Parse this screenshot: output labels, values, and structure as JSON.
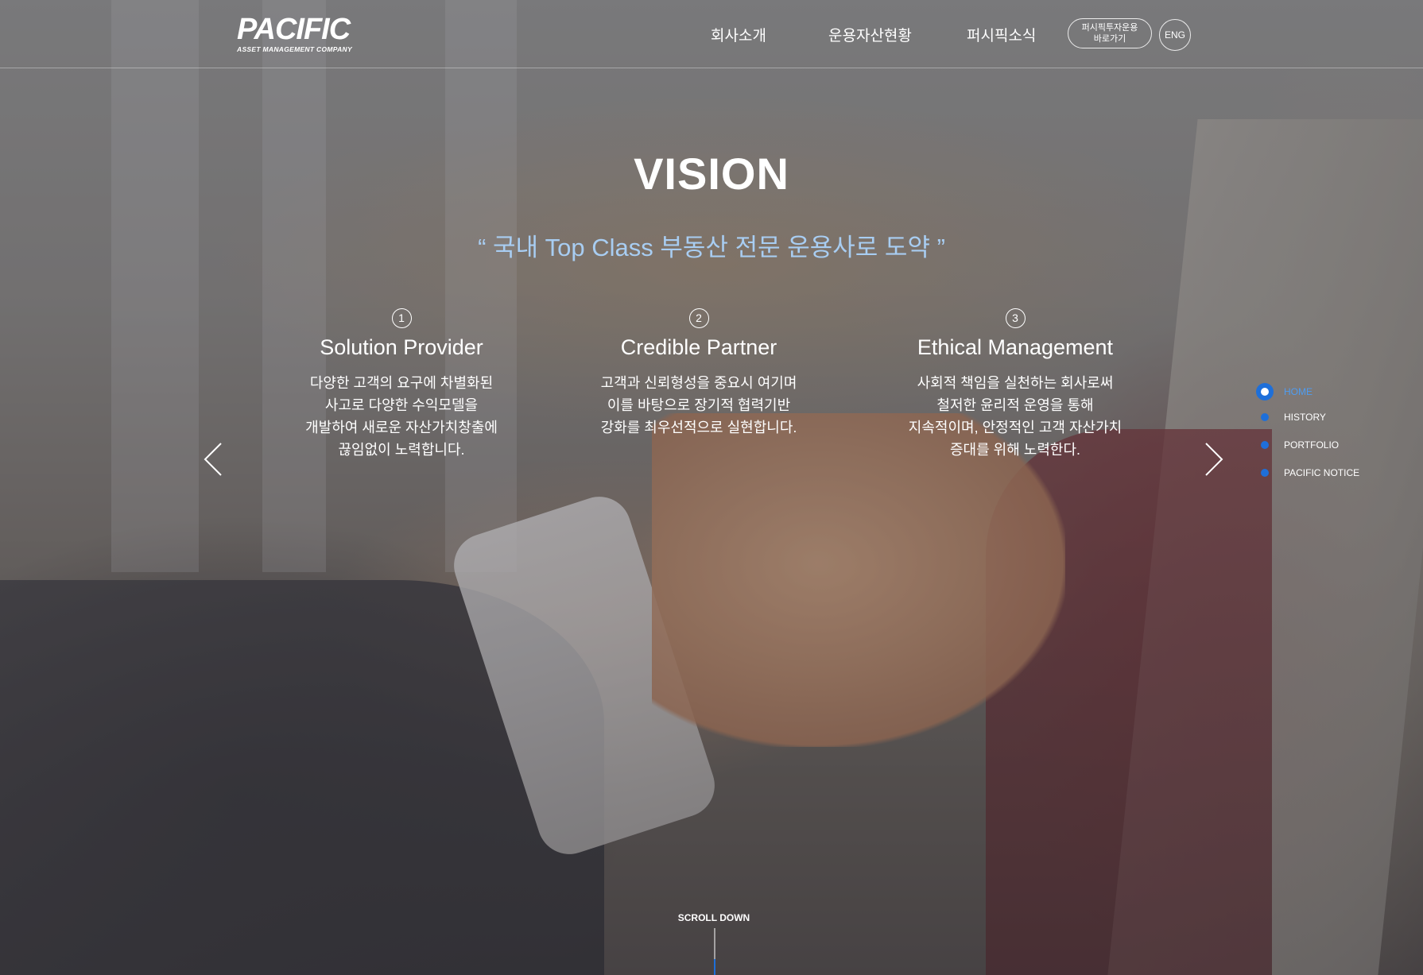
{
  "header": {
    "logo_main": "PACIFIC",
    "logo_sub": "ASSET MANAGEMENT COMPANY",
    "nav": [
      "회사소개",
      "운용자산현황",
      "퍼시픽소식"
    ],
    "shortcut_line1": "퍼시픽투자운용",
    "shortcut_line2": "바로가기",
    "lang": "ENG"
  },
  "hero": {
    "title": "VISION",
    "quote": "“ 국내 Top Class 부동산 전문 운용사로 도약 ”",
    "pillars": [
      {
        "num": "1",
        "title": "Solution Provider",
        "desc": "다양한 고객의 요구에 차별화된\n사고로 다양한 수익모델을\n개발하여 새로운 자산가치창출에\n끊임없이 노력합니다."
      },
      {
        "num": "2",
        "title": "Credible Partner",
        "desc": "고객과 신뢰형성을 중요시 여기며\n이를 바탕으로 장기적 협력기반\n강화를 최우선적으로 실현합니다."
      },
      {
        "num": "3",
        "title": "Ethical Management",
        "desc": "사회적 책임을 실천하는 회사로써\n철저한 윤리적 운영을 통해\n지속적이며, 안정적인 고객 자산가치\n증대를 위해 노력한다."
      }
    ]
  },
  "side_nav": {
    "items": [
      "HOME",
      "HISTORY",
      "PORTFOLIO",
      "PACIFIC NOTICE"
    ],
    "active": "HOME"
  },
  "scroll": {
    "label": "SCROLL DOWN"
  },
  "icons": {
    "prev": "chevron-left-icon",
    "next": "chevron-right-icon"
  },
  "colors": {
    "accent": "#1e6fd9",
    "quote": "#a8cdf2"
  }
}
